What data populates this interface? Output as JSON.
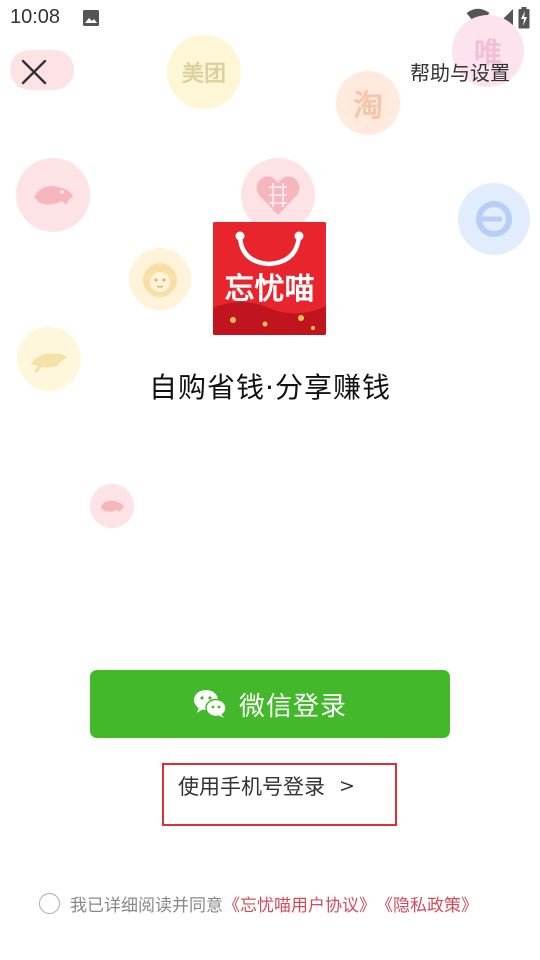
{
  "status_bar": {
    "time": "10:08"
  },
  "header": {
    "help_label": "帮助与设置"
  },
  "background_bubbles": {
    "meituan_text": "美团",
    "taobao_text": "淘",
    "wei_text": "唯"
  },
  "app": {
    "logo_text": "忘忧喵",
    "slogan": "自购省钱·分享赚钱"
  },
  "login": {
    "wechat_label": "微信登录",
    "phone_label": "使用手机号登录",
    "phone_arrow": ">"
  },
  "agreement": {
    "prefix": "我已详细阅读并同意",
    "user_agreement": "《忘忧喵用户协议》",
    "privacy_policy": "《隐私政策》"
  },
  "colors": {
    "wechat_green": "#43b82b",
    "logo_red": "#e8242d",
    "link_red": "#d44b5b",
    "highlight_box": "#d9303a"
  }
}
